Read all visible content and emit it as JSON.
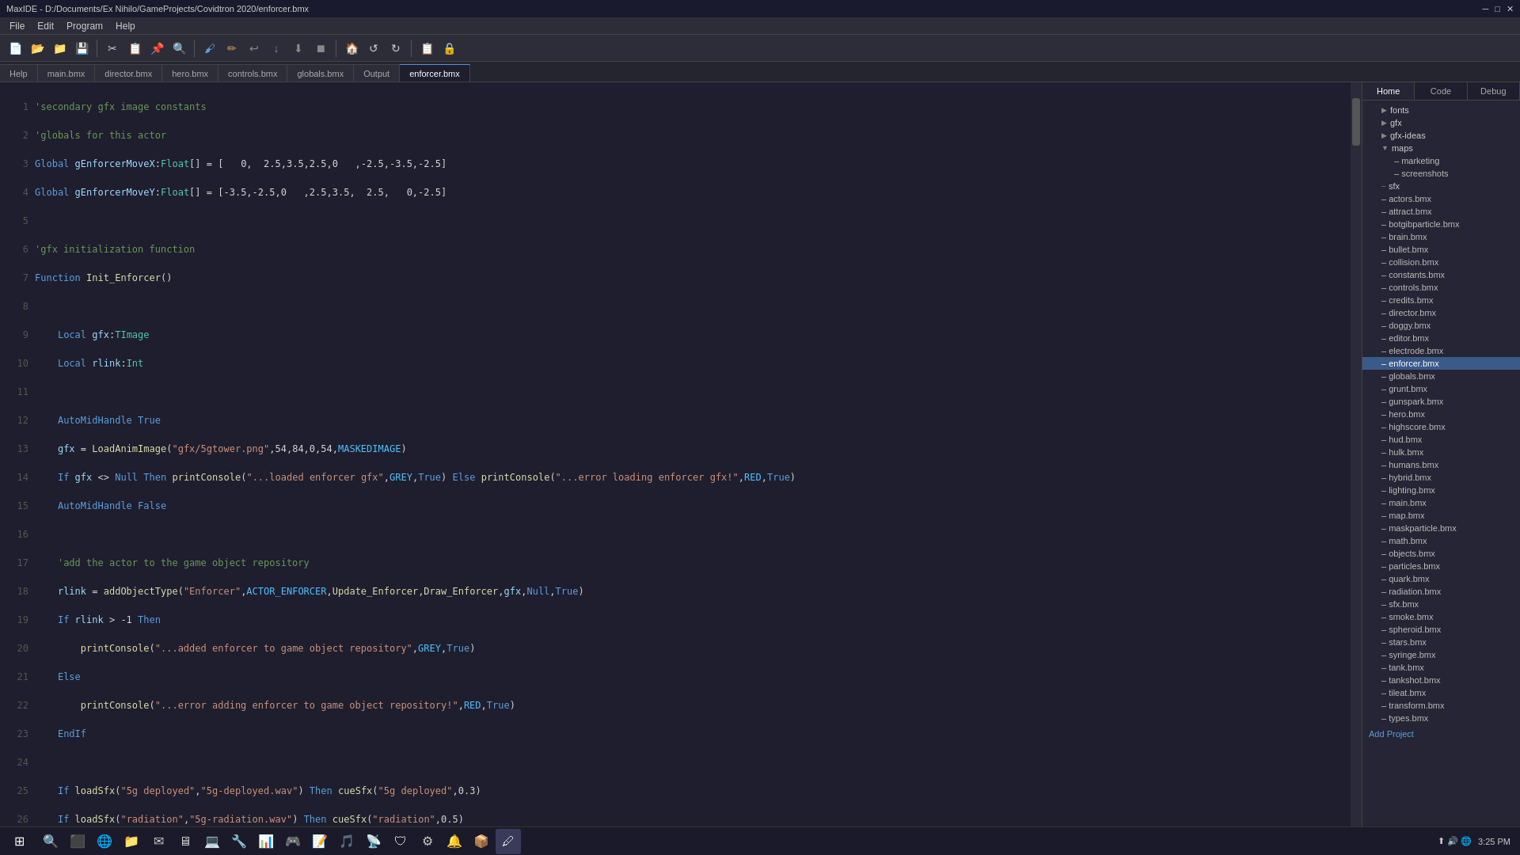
{
  "titlebar": {
    "title": "MaxIDE - D:/Documents/Ex Nihilo/GameProjects/Covidtron 2020/enforcer.bmx",
    "min": "─",
    "max": "□",
    "close": "✕"
  },
  "menubar": {
    "items": [
      "File",
      "Edit",
      "Program",
      "Help"
    ]
  },
  "tabs": {
    "items": [
      "Help",
      "main.bmx",
      "director.bmx",
      "hero.bmx",
      "controls.bmx",
      "globals.bmx",
      "Output",
      "enforcer.bmx"
    ],
    "active": "enforcer.bmx"
  },
  "sidebar": {
    "tabs": [
      "Home",
      "Code",
      "Debug"
    ],
    "active": "Home",
    "tree": [
      {
        "label": "fonts",
        "indent": 1,
        "type": "folder",
        "collapsed": true
      },
      {
        "label": "gfx",
        "indent": 1,
        "type": "folder",
        "collapsed": true
      },
      {
        "label": "gfx-ideas",
        "indent": 1,
        "type": "folder",
        "collapsed": true
      },
      {
        "label": "maps",
        "indent": 1,
        "type": "folder",
        "expanded": true
      },
      {
        "label": "marketing",
        "indent": 2,
        "type": "folder"
      },
      {
        "label": "screenshots",
        "indent": 2,
        "type": "folder"
      },
      {
        "label": "sfx",
        "indent": 1,
        "type": "folder"
      },
      {
        "label": "actors.bmx",
        "indent": 1
      },
      {
        "label": "attract.bmx",
        "indent": 1
      },
      {
        "label": "botgibparticle.bmx",
        "indent": 1
      },
      {
        "label": "brain.bmx",
        "indent": 1
      },
      {
        "label": "bullet.bmx",
        "indent": 1
      },
      {
        "label": "collision.bmx",
        "indent": 1
      },
      {
        "label": "constants.bmx",
        "indent": 1
      },
      {
        "label": "controls.bmx",
        "indent": 1
      },
      {
        "label": "credits.bmx",
        "indent": 1
      },
      {
        "label": "director.bmx",
        "indent": 1
      },
      {
        "label": "doggy.bmx",
        "indent": 1
      },
      {
        "label": "editor.bmx",
        "indent": 1
      },
      {
        "label": "electrode.bmx",
        "indent": 1
      },
      {
        "label": "enforcer.bmx",
        "indent": 1,
        "selected": true
      },
      {
        "label": "globals.bmx",
        "indent": 1
      },
      {
        "label": "grunt.bmx",
        "indent": 1
      },
      {
        "label": "gunspark.bmx",
        "indent": 1
      },
      {
        "label": "hero.bmx",
        "indent": 1
      },
      {
        "label": "highscore.bmx",
        "indent": 1
      },
      {
        "label": "hud.bmx",
        "indent": 1
      },
      {
        "label": "hulk.bmx",
        "indent": 1
      },
      {
        "label": "humans.bmx",
        "indent": 1
      },
      {
        "label": "hybrid.bmx",
        "indent": 1
      },
      {
        "label": "lighting.bmx",
        "indent": 1
      },
      {
        "label": "main.bmx",
        "indent": 1
      },
      {
        "label": "map.bmx",
        "indent": 1
      },
      {
        "label": "maskparticle.bmx",
        "indent": 1
      },
      {
        "label": "math.bmx",
        "indent": 1
      },
      {
        "label": "objects.bmx",
        "indent": 1
      },
      {
        "label": "particles.bmx",
        "indent": 1
      },
      {
        "label": "quark.bmx",
        "indent": 1
      },
      {
        "label": "radiation.bmx",
        "indent": 1
      },
      {
        "label": "sfx.bmx",
        "indent": 1
      },
      {
        "label": "smoke.bmx",
        "indent": 1
      },
      {
        "label": "spheroid.bmx",
        "indent": 1
      },
      {
        "label": "stars.bmx",
        "indent": 1
      },
      {
        "label": "syringe.bmx",
        "indent": 1
      },
      {
        "label": "tank.bmx",
        "indent": 1
      },
      {
        "label": "tankshot.bmx",
        "indent": 1
      },
      {
        "label": "tileat.bmx",
        "indent": 1
      },
      {
        "label": "transform.bmx",
        "indent": 1
      },
      {
        "label": "types.bmx",
        "indent": 1
      },
      {
        "label": "Add Project",
        "indent": 0,
        "special": true
      }
    ]
  },
  "statusbar": {
    "text": ""
  },
  "taskbar": {
    "time": "3:25 PM"
  }
}
